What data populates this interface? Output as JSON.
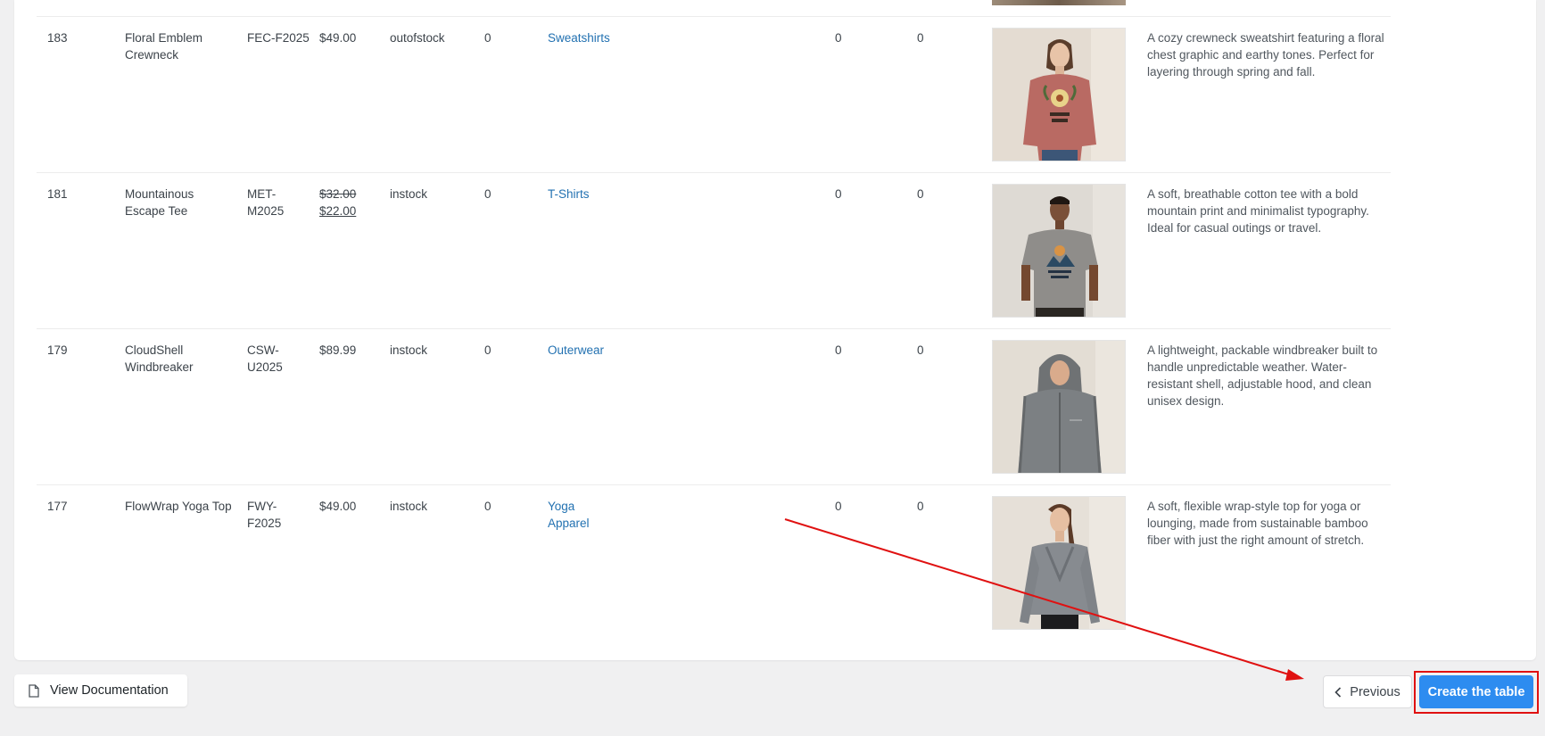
{
  "table": {
    "rows": [
      {
        "id": "183",
        "name": "Floral Emblem Crewneck",
        "sku": "FEC-F2025",
        "price": "$49.00",
        "sale_price": "",
        "stock_status": "outofstock",
        "qty_a": "0",
        "category": "Sweatshirts",
        "qty_b": "0",
        "qty_c": "0",
        "image_alt": "sweatshirt-photo",
        "description": "A cozy crewneck sweatshirt featuring a floral chest graphic and earthy tones. Perfect for layering through spring and fall."
      },
      {
        "id": "181",
        "name": "Mountainous Escape Tee",
        "sku": "MET-M2025",
        "price": "$32.00",
        "sale_price": "$22.00",
        "stock_status": "instock",
        "qty_a": "0",
        "category": "T-Shirts",
        "qty_b": "0",
        "qty_c": "0",
        "image_alt": "tshirt-photo",
        "description": "A soft, breathable cotton tee with a bold mountain print and minimalist typography. Ideal for casual outings or travel."
      },
      {
        "id": "179",
        "name": "CloudShell Windbreaker",
        "sku": "CSW-U2025",
        "price": "$89.99",
        "sale_price": "",
        "stock_status": "instock",
        "qty_a": "0",
        "category": "Outerwear",
        "qty_b": "0",
        "qty_c": "0",
        "image_alt": "windbreaker-photo",
        "description": "A lightweight, packable windbreaker built to handle unpredictable weather. Water-resistant shell, adjustable hood, and clean unisex design."
      },
      {
        "id": "177",
        "name": "FlowWrap Yoga Top",
        "sku": "FWY-F2025",
        "price": "$49.00",
        "sale_price": "",
        "stock_status": "instock",
        "qty_a": "0",
        "category": "Yoga Apparel",
        "qty_b": "0",
        "qty_c": "0",
        "image_alt": "yoga-top-photo",
        "description": "A soft, flexible wrap-style top for yoga or lounging, made from sustainable bamboo fiber with just the right amount of stretch."
      }
    ]
  },
  "footer": {
    "doc_label": "View Documentation",
    "doc_icon": "file-icon",
    "prev_label": "Previous",
    "prev_icon": "chevron-left-icon",
    "create_label": "Create the table"
  },
  "colors": {
    "accent": "#2d8cf0",
    "link": "#2271b1",
    "annotation": "#e01111"
  }
}
